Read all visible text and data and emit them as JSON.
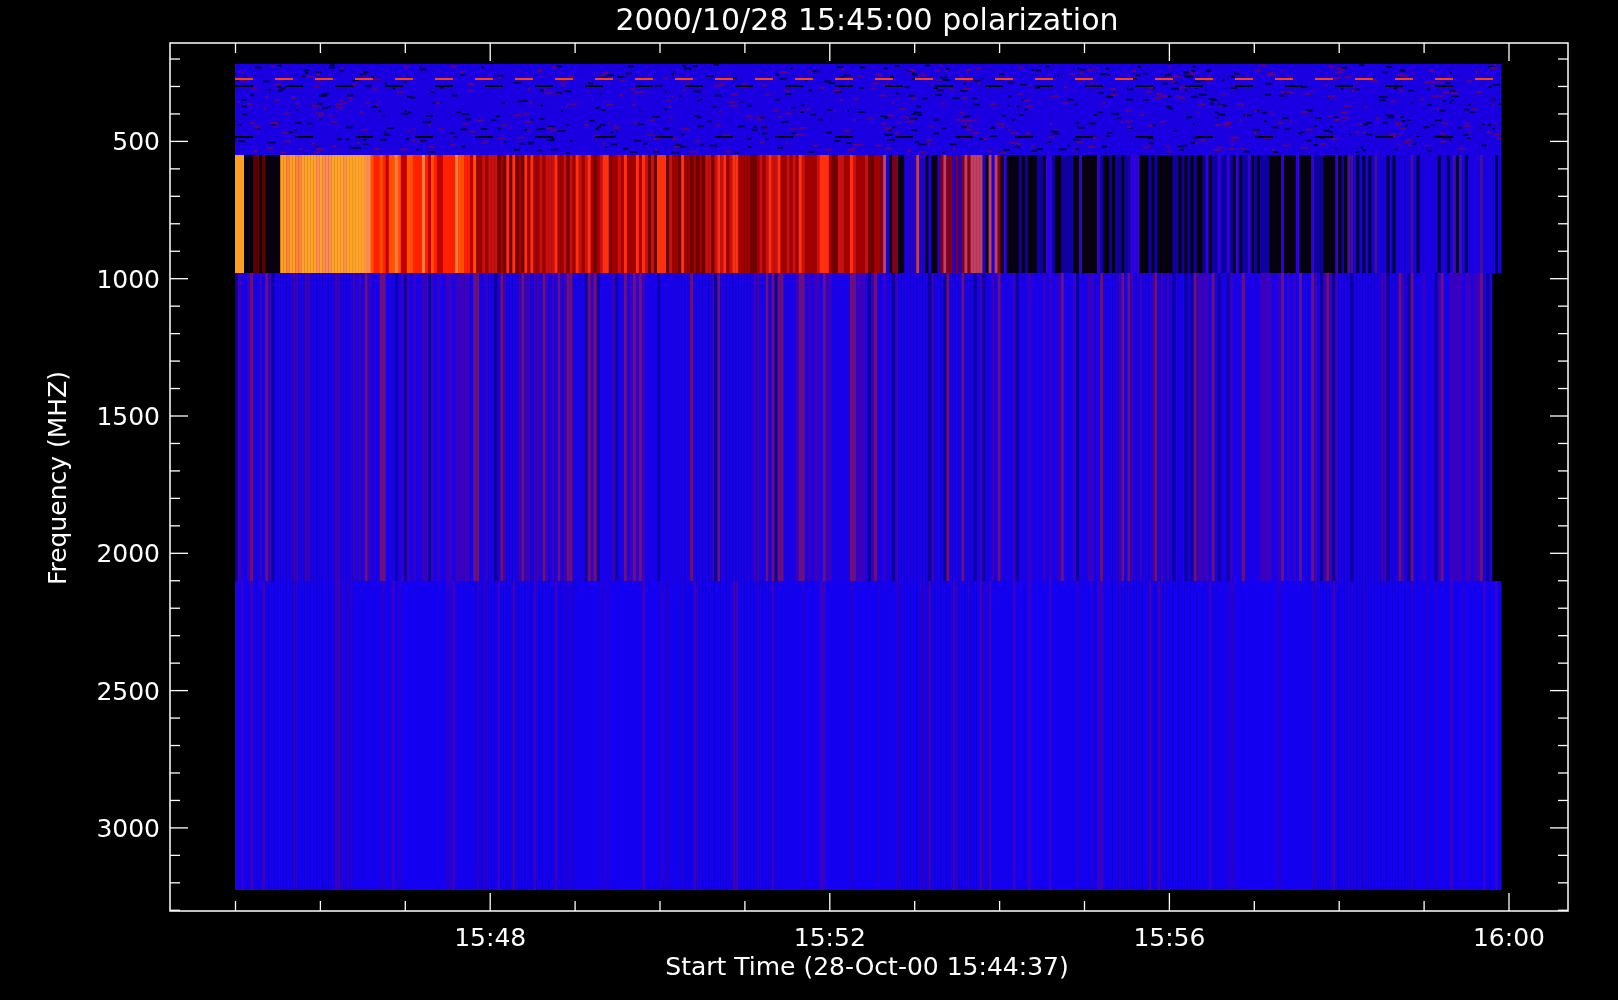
{
  "title": "2000/10/28 15:45:00 polarization",
  "y_axis": {
    "label": "Frequency (MHZ)",
    "ticks": [
      "500",
      "1000",
      "1500",
      "2000",
      "2500",
      "3000"
    ]
  },
  "x_axis": {
    "label": "Start Time (28-Oct-00 15:44:37)",
    "ticks": [
      "15:48",
      "15:52",
      "15:56",
      "16:00"
    ]
  }
}
